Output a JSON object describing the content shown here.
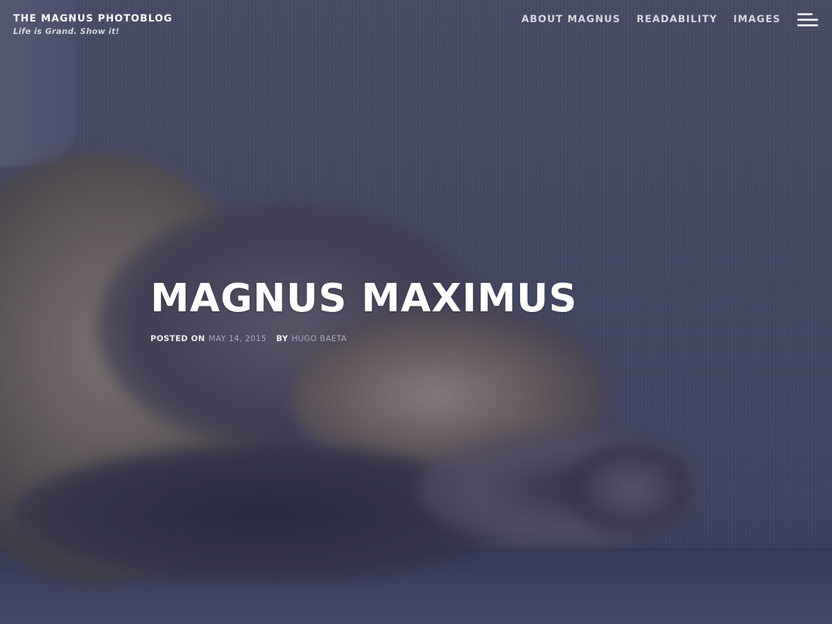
{
  "site": {
    "title": "THE MAGNUS PHOTOBLOG",
    "description": "Life is Grand. Show it!"
  },
  "nav": {
    "items": [
      {
        "label": "ABOUT MAGNUS"
      },
      {
        "label": "READABILITY"
      },
      {
        "label": "IMAGES"
      }
    ],
    "menu_icon": "hamburger-menu-icon"
  },
  "hero": {
    "image": "sleeping-tabby-cat-on-sofa",
    "overlay_color": "#282a52"
  },
  "post": {
    "title": "MAGNUS MAXIMUS",
    "posted_on_label": "POSTED ON",
    "date": "MAY 14, 2015",
    "by_label": "BY",
    "author": "HUGO BAETA"
  },
  "colors": {
    "text_primary": "#ffffff",
    "text_muted": "#a9abbd",
    "nav_text": "#d6d7e0"
  }
}
